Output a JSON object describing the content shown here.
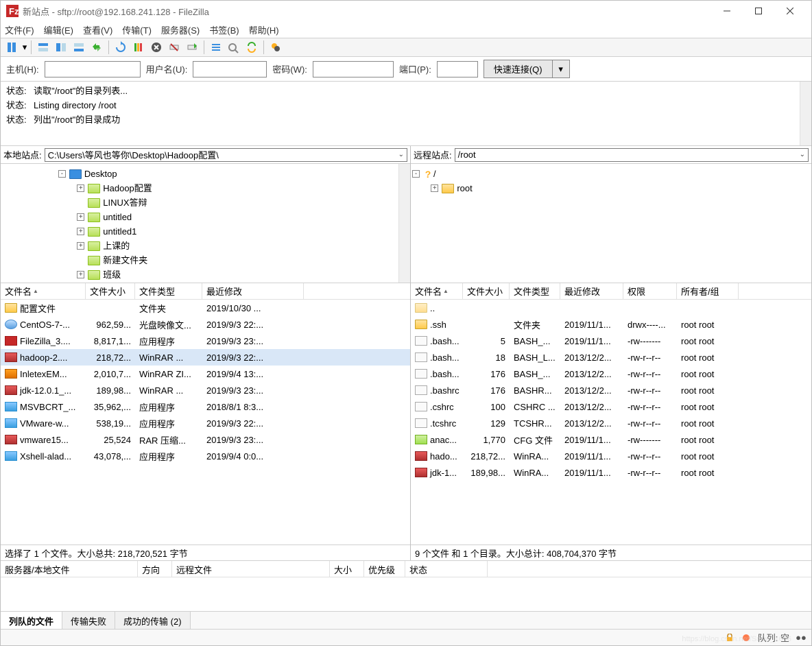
{
  "titlebar": {
    "title": "新站点 - sftp://root@192.168.241.128 - FileZilla"
  },
  "menu": [
    "文件(F)",
    "编辑(E)",
    "查看(V)",
    "传输(T)",
    "服务器(S)",
    "书签(B)",
    "帮助(H)"
  ],
  "quickbar": {
    "host_label": "主机(H):",
    "user_label": "用户名(U):",
    "pass_label": "密码(W):",
    "port_label": "端口(P):",
    "connect": "快速连接(Q)",
    "host_value": "",
    "user_value": "",
    "pass_value": "",
    "port_value": ""
  },
  "log": [
    {
      "lbl": "状态:",
      "msg": "读取\"/root\"的目录列表..."
    },
    {
      "lbl": "状态:",
      "msg": "Listing directory /root"
    },
    {
      "lbl": "状态:",
      "msg": "列出\"/root\"的目录成功"
    }
  ],
  "local": {
    "path_label": "本地站点:",
    "path_value": "C:\\Users\\等风也等你\\Desktop\\Hadoop配置\\",
    "tree": [
      {
        "indent": 6,
        "toggle": "-",
        "label": "Desktop",
        "icon": "blue"
      },
      {
        "indent": 8,
        "toggle": "+",
        "label": "Hadoop配置",
        "icon": "green"
      },
      {
        "indent": 8,
        "toggle": "",
        "label": "LINUX答辩",
        "icon": "green"
      },
      {
        "indent": 8,
        "toggle": "+",
        "label": "untitled",
        "icon": "green"
      },
      {
        "indent": 8,
        "toggle": "+",
        "label": "untitled1",
        "icon": "green"
      },
      {
        "indent": 8,
        "toggle": "+",
        "label": "上课的",
        "icon": "green"
      },
      {
        "indent": 8,
        "toggle": "",
        "label": "新建文件夹",
        "icon": "green"
      },
      {
        "indent": 8,
        "toggle": "+",
        "label": "班级",
        "icon": "green"
      }
    ],
    "cols": [
      "文件名",
      "文件大小",
      "文件类型",
      "最近修改"
    ],
    "rows": [
      {
        "icon": "folder",
        "name": "配置文件",
        "size": "",
        "type": "文件夹",
        "date": "2019/10/30 ..."
      },
      {
        "icon": "iso",
        "name": "CentOS-7-...",
        "size": "962,59...",
        "type": "光盘映像文...",
        "date": "2019/9/3 22:..."
      },
      {
        "icon": "fz",
        "name": "FileZilla_3....",
        "size": "8,817,1...",
        "type": "应用程序",
        "date": "2019/9/3 23:..."
      },
      {
        "icon": "rar",
        "name": "hadoop-2....",
        "size": "218,72...",
        "type": "WinRAR ...",
        "date": "2019/9/3 22:...",
        "selected": true
      },
      {
        "icon": "zip",
        "name": "InletexEM...",
        "size": "2,010,7...",
        "type": "WinRAR ZI...",
        "date": "2019/9/4 13:..."
      },
      {
        "icon": "rar",
        "name": "jdk-12.0.1_...",
        "size": "189,98...",
        "type": "WinRAR ...",
        "date": "2019/9/3 23:..."
      },
      {
        "icon": "exe",
        "name": "MSVBCRT_...",
        "size": "35,962,...",
        "type": "应用程序",
        "date": "2018/8/1 8:3..."
      },
      {
        "icon": "exe",
        "name": "VMware-w...",
        "size": "538,19...",
        "type": "应用程序",
        "date": "2019/9/3 22:..."
      },
      {
        "icon": "rar",
        "name": "vmware15...",
        "size": "25,524",
        "type": "RAR 压缩...",
        "date": "2019/9/3 23:..."
      },
      {
        "icon": "exe",
        "name": "Xshell-alad...",
        "size": "43,078,...",
        "type": "应用程序",
        "date": "2019/9/4 0:0..."
      }
    ],
    "status": "选择了 1 个文件。大小总共: 218,720,521 字节"
  },
  "remote": {
    "path_label": "远程站点:",
    "path_value": "/root",
    "tree": [
      {
        "indent": 0,
        "toggle": "-",
        "label": "/",
        "icon": "help"
      },
      {
        "indent": 2,
        "toggle": "+",
        "label": "root",
        "icon": "folder"
      }
    ],
    "cols": [
      "文件名",
      "文件大小",
      "文件类型",
      "最近修改",
      "权限",
      "所有者/组"
    ],
    "rows": [
      {
        "icon": "blank",
        "name": "..",
        "size": "",
        "type": "",
        "date": "",
        "perm": "",
        "own": ""
      },
      {
        "icon": "folder",
        "name": ".ssh",
        "size": "",
        "type": "文件夹",
        "date": "2019/11/1...",
        "perm": "drwx----...",
        "own": "root root"
      },
      {
        "icon": "doc",
        "name": ".bash...",
        "size": "5",
        "type": "BASH_...",
        "date": "2019/11/1...",
        "perm": "-rw-------",
        "own": "root root"
      },
      {
        "icon": "doc",
        "name": ".bash...",
        "size": "18",
        "type": "BASH_L...",
        "date": "2013/12/2...",
        "perm": "-rw-r--r--",
        "own": "root root"
      },
      {
        "icon": "doc",
        "name": ".bash...",
        "size": "176",
        "type": "BASH_...",
        "date": "2013/12/2...",
        "perm": "-rw-r--r--",
        "own": "root root"
      },
      {
        "icon": "doc",
        "name": ".bashrc",
        "size": "176",
        "type": "BASHR...",
        "date": "2013/12/2...",
        "perm": "-rw-r--r--",
        "own": "root root"
      },
      {
        "icon": "doc",
        "name": ".cshrc",
        "size": "100",
        "type": "CSHRC ...",
        "date": "2013/12/2...",
        "perm": "-rw-r--r--",
        "own": "root root"
      },
      {
        "icon": "doc",
        "name": ".tcshrc",
        "size": "129",
        "type": "TCSHR...",
        "date": "2013/12/2...",
        "perm": "-rw-r--r--",
        "own": "root root"
      },
      {
        "icon": "cfg",
        "name": "anac...",
        "size": "1,770",
        "type": "CFG 文件",
        "date": "2019/11/1...",
        "perm": "-rw-------",
        "own": "root root"
      },
      {
        "icon": "rar",
        "name": "hado...",
        "size": "218,72...",
        "type": "WinRA...",
        "date": "2019/11/1...",
        "perm": "-rw-r--r--",
        "own": "root root"
      },
      {
        "icon": "rar",
        "name": "jdk-1...",
        "size": "189,98...",
        "type": "WinRA...",
        "date": "2019/11/1...",
        "perm": "-rw-r--r--",
        "own": "root root"
      }
    ],
    "status": "9 个文件 和 1 个目录。大小总计: 408,704,370 字节"
  },
  "queue": {
    "cols": {
      "server": "服务器/本地文件",
      "dir": "方向",
      "remote": "远程文件",
      "size": "大小",
      "prio": "优先级",
      "status": "状态"
    },
    "tabs": [
      "列队的文件",
      "传输失败",
      "成功的传输 (2)"
    ],
    "active_tab": 0
  },
  "statusbar": {
    "queue_label": "队列: 空",
    "watermark": "https://blog.csdn.net/Snow_1666"
  }
}
